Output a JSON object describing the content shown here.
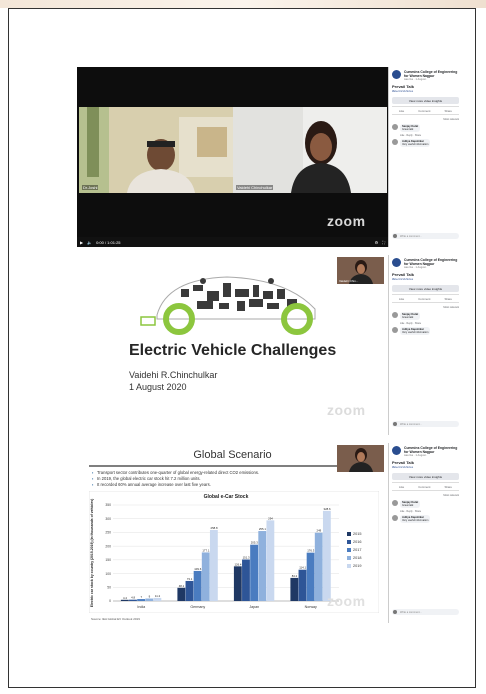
{
  "zoom_brand": "zoom",
  "facebook_panel": {
    "page_name": "Cummins College of Engineering for Women Nagpur",
    "post_meta": "was live · 1 August · ",
    "post_title": "Prevail Talk",
    "hashtag": "#ElectricVehicles",
    "insights_button": "View more video insights",
    "actions": [
      "Like",
      "Comment",
      "Share"
    ],
    "sort_label": "Most relevant",
    "comments": [
      {
        "name": "Sanjay Kulat",
        "text": "Great talk"
      },
      {
        "name": "Aditya Kapshikar",
        "text": "Very useful information"
      }
    ],
    "comment_links": "Like · Reply · Share",
    "comment_placeholder": "Write a comment..."
  },
  "screen_1": {
    "participant_1_label": "Dr.Joshi",
    "participant_2_label": "Vaidehi Chinchulkar",
    "time_readout": "0:00 / 1:01:25"
  },
  "screen_2": {
    "slide_title": "Electric Vehicle Challenges",
    "author": "Vaidehi R.Chinchulkar",
    "date": "1 August 2020",
    "thumbnail_label": "Vaidehi Chin..."
  },
  "screen_3": {
    "slide_title": "Global Scenario",
    "bullets": [
      "Transport sector contributes one-quarter of global energy-related direct CO2 emissions.",
      "In 2019, the global electric car stock hit 7.2 million units.",
      "It recorded 60% annual average increase over last five years."
    ],
    "source": "Source: IEA Global EV Outlook 2019"
  },
  "chart_data": {
    "type": "bar",
    "title": "Global e-Car Stock",
    "ylabel": "Electric car stock by country (2015-2019) (in thousands of vehicles)",
    "ylim": [
      0,
      350
    ],
    "yticks": [
      0,
      50,
      100,
      150,
      200,
      250,
      300,
      350
    ],
    "categories": [
      "India",
      "Germany",
      "Japan",
      "Norway"
    ],
    "series": [
      {
        "name": "2015",
        "color": "#1f3864",
        "values": [
          4.4,
          48.1,
          126.4,
          84.2
        ]
      },
      {
        "name": "2016",
        "color": "#2e5597",
        "values": [
          4.8,
          73.1,
          151.3,
          114.1
        ]
      },
      {
        "name": "2017",
        "color": "#4a7cc0",
        "values": [
          7.0,
          109.6,
          205.3,
          176.3
        ]
      },
      {
        "name": "2018",
        "color": "#8fb1dd",
        "values": [
          9.0,
          177.1,
          255.1,
          249.0
        ]
      },
      {
        "name": "2019",
        "color": "#c9d8ef",
        "values": [
          11.2,
          258.8,
          294.0,
          328.6
        ]
      }
    ],
    "data_labels": {
      "India": [
        "4.4",
        "4.8",
        "7",
        "9",
        "11.2"
      ],
      "Germany": [
        "48.1",
        "73.1",
        "109.6",
        "177.1",
        "258.8"
      ],
      "Japan": [
        "126.4",
        "151.3",
        "205.3",
        "255.1",
        "294"
      ],
      "Norway": [
        "84.2",
        "114.1",
        "176.3",
        "249",
        "328.6"
      ]
    },
    "legend_position": "right",
    "grid": true
  }
}
